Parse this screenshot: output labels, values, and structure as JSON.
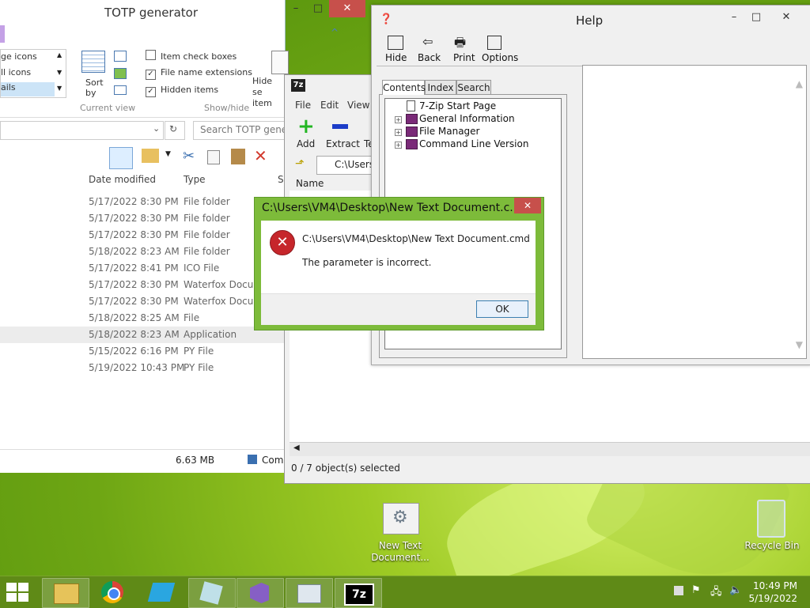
{
  "explorer": {
    "title": "TOTP generator",
    "ribbon": {
      "layout_items": [
        "ge icons",
        "ll icons",
        "ails"
      ],
      "sort_label": "Sort by",
      "group_current_view": "Current view",
      "checkbox_item": "Item check boxes",
      "checkbox_ext": "File name extensions",
      "checkbox_hidden": "Hidden items",
      "hide_selected": "Hide se item",
      "group_show_hide": "Show/hide"
    },
    "search_placeholder": "Search TOTP genera",
    "columns": {
      "date": "Date modified",
      "type": "Type",
      "size": "S"
    },
    "rows": [
      {
        "date": "5/17/2022 8:30 PM",
        "type": "File folder"
      },
      {
        "date": "5/17/2022 8:30 PM",
        "type": "File folder"
      },
      {
        "date": "5/17/2022 8:30 PM",
        "type": "File folder"
      },
      {
        "date": "5/18/2022 8:23 AM",
        "type": "File folder"
      },
      {
        "date": "5/17/2022 8:41 PM",
        "type": "ICO File"
      },
      {
        "date": "5/17/2022 8:30 PM",
        "type": "Waterfox Docum"
      },
      {
        "date": "5/17/2022 8:30 PM",
        "type": "Waterfox Docum"
      },
      {
        "date": "5/18/2022 8:25 AM",
        "type": "File"
      },
      {
        "date": "5/18/2022 8:23 AM",
        "type": "Application"
      },
      {
        "date": "5/15/2022 6:16 PM",
        "type": "PY File"
      },
      {
        "date": "5/19/2022 10:43 PM",
        "type": "PY File"
      }
    ],
    "status_size": "6.63 MB",
    "status_com": "Com"
  },
  "sevenzip": {
    "title_icon": "7z",
    "menu": [
      "File",
      "Edit",
      "View"
    ],
    "toolbar": [
      "Add",
      "Extract",
      "Te"
    ],
    "path": "C:\\Users\\",
    "col_name": "Name",
    "status": "0 / 7 object(s) selected"
  },
  "help": {
    "title": "Help",
    "toolbar": [
      "Hide",
      "Back",
      "Print",
      "Options"
    ],
    "tabs": [
      "Contents",
      "Index",
      "Search"
    ],
    "tree": [
      "7-Zip Start Page",
      "General Information",
      "File Manager",
      "Command Line Version"
    ]
  },
  "error_dialog": {
    "title": "C:\\Users\\VM4\\Desktop\\New Text Document.c...",
    "path": "C:\\Users\\VM4\\Desktop\\New Text Document.cmd",
    "message": "The parameter is incorrect.",
    "ok_label": "OK"
  },
  "desktop": {
    "file_icon_label": "New Text Document...",
    "recycle_label": "Recycle Bin"
  },
  "taskbar": {
    "time": "10:49 PM",
    "date": "5/19/2022",
    "sevenzip_label": "7z"
  },
  "colors": {
    "accent_green": "#7dbb3a",
    "close_red": "#c7504b",
    "taskbar": "#5f8a17"
  }
}
